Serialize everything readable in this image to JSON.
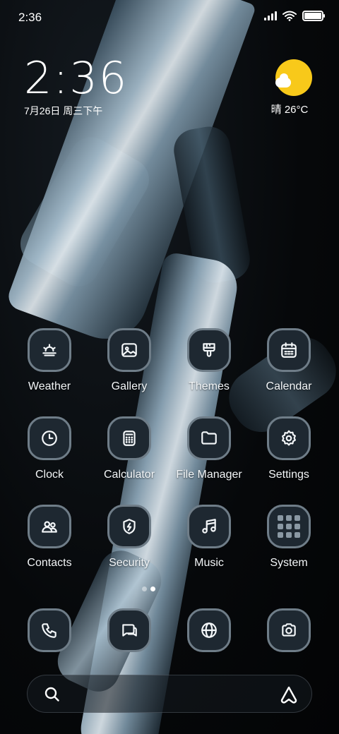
{
  "status_bar": {
    "time": "2:36",
    "icons": [
      "signal-icon",
      "wifi-icon",
      "battery-icon"
    ]
  },
  "clock_widget": {
    "time": "2:36",
    "date": "7月26日 周三下午"
  },
  "weather_widget": {
    "icon": "sunny-cloud-icon",
    "text": "晴 26°C"
  },
  "apps": [
    {
      "label": "Weather",
      "icon": "weather-icon"
    },
    {
      "label": "Gallery",
      "icon": "gallery-icon"
    },
    {
      "label": "Themes",
      "icon": "themes-icon"
    },
    {
      "label": "Calendar",
      "icon": "calendar-icon"
    },
    {
      "label": "Clock",
      "icon": "clock-icon"
    },
    {
      "label": "Calculator",
      "icon": "calculator-icon"
    },
    {
      "label": "File Manager",
      "icon": "folder-icon"
    },
    {
      "label": "Settings",
      "icon": "gear-icon"
    },
    {
      "label": "Contacts",
      "icon": "contacts-icon"
    },
    {
      "label": "Security",
      "icon": "shield-icon"
    },
    {
      "label": "Music",
      "icon": "music-icon"
    },
    {
      "label": "System",
      "icon": "folder-grid-icon"
    }
  ],
  "dock": [
    "phone-icon",
    "messages-icon",
    "browser-icon",
    "camera-icon"
  ],
  "pager": {
    "pages": 2,
    "active": 2
  },
  "search_bar": {
    "left_icon": "search-icon",
    "right_icon": "assistant-icon"
  },
  "colors": {
    "sun": "#f8c91a",
    "icon_bg": "#1e2831",
    "icon_border": "#6f7d88"
  }
}
